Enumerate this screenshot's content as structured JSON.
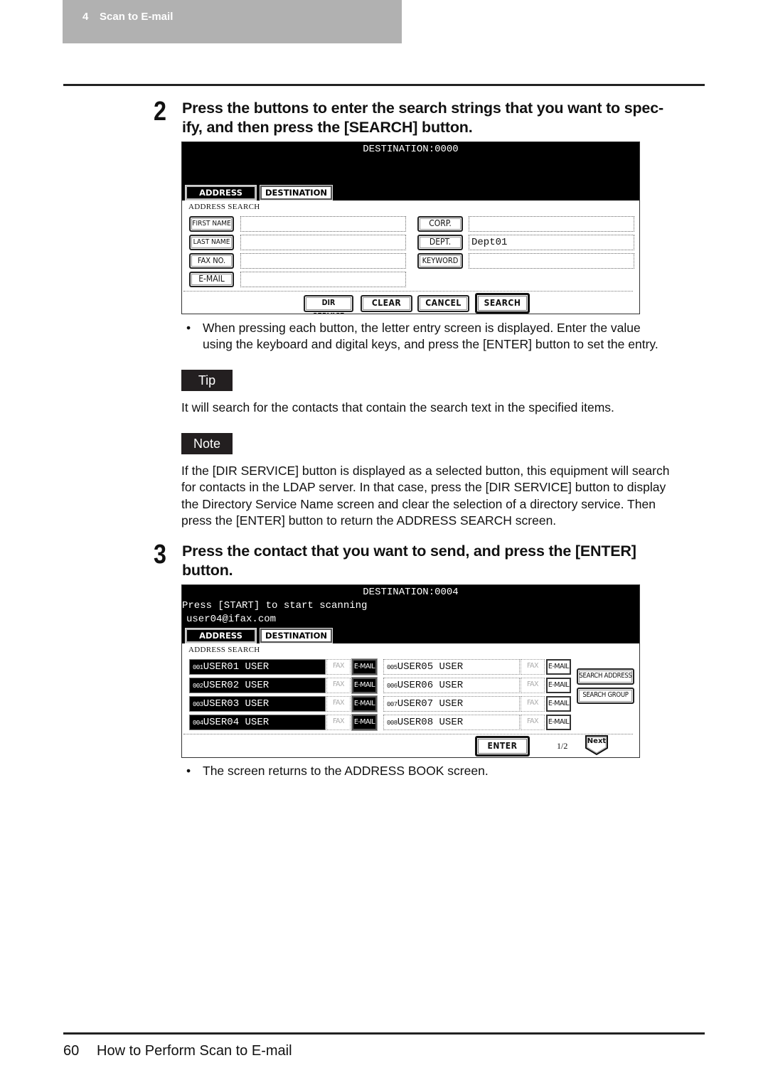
{
  "header": {
    "chapter_number": "4",
    "chapter_title": "Scan to E-mail"
  },
  "step2": {
    "number": "2",
    "instruction": "Press the buttons to enter the search strings that you want to spec-ify, and then press the [SEARCH] button.",
    "instruction_line1": "Press the buttons to enter the search strings that you want to spec-",
    "instruction_line2": "ify, and then press the [SEARCH] button.",
    "screen": {
      "destination": "DESTINATION:0000",
      "tabs": [
        {
          "label": "ADDRESS",
          "active": true
        },
        {
          "label": "DESTINATION",
          "active": false
        }
      ],
      "section_label": "ADDRESS SEARCH",
      "left_fields": [
        {
          "button": "FIRST NAME",
          "value": ""
        },
        {
          "button": "LAST NAME",
          "value": ""
        },
        {
          "button": "FAX NO.",
          "value": ""
        },
        {
          "button": "E-MAIL",
          "value": ""
        }
      ],
      "right_fields": [
        {
          "button": "CORP.",
          "value": ""
        },
        {
          "button": "DEPT.",
          "value": "Dept01"
        },
        {
          "button": "KEYWORD",
          "value": ""
        }
      ],
      "actions": {
        "dir_service": "DIR SERVICE",
        "clear": "CLEAR",
        "cancel": "CANCEL",
        "search": "SEARCH"
      }
    },
    "bullet_line1": "When pressing each button, the letter entry screen is displayed.  Enter the value",
    "bullet_line2": "using the keyboard and digital keys, and press the [ENTER] button to set the entry."
  },
  "tip": {
    "label": "Tip",
    "text": "It will search for the contacts that contain the search text in the specified items."
  },
  "note": {
    "label": "Note",
    "lines": [
      "If the [DIR SERVICE] button is displayed as a selected button, this equipment will search",
      "for contacts in the LDAP server.  In that case, press the [DIR SERVICE] button to display",
      "the Directory Service Name screen and clear the selection of a directory service.  Then",
      "press the [ENTER] button to return the ADDRESS SEARCH screen."
    ]
  },
  "step3": {
    "number": "3",
    "instruction_line1": "Press the contact that you want to send, and press the [ENTER]",
    "instruction_line2": "button.",
    "screen": {
      "destination": "DESTINATION:0004",
      "message": "Press [START] to start scanning",
      "selected_address": "user04@ifax.com",
      "tabs": [
        {
          "label": "ADDRESS",
          "active": true
        },
        {
          "label": "DESTINATION",
          "active": false
        }
      ],
      "section_label": "ADDRESS SEARCH",
      "entries": [
        {
          "index": "001",
          "name": "USER01 USER",
          "selected": true,
          "fax": "FAX",
          "email": "E-MAIL"
        },
        {
          "index": "002",
          "name": "USER02 USER",
          "selected": true,
          "fax": "FAX",
          "email": "E-MAIL"
        },
        {
          "index": "003",
          "name": "USER03 USER",
          "selected": true,
          "fax": "FAX",
          "email": "E-MAIL"
        },
        {
          "index": "004",
          "name": "USER04 USER",
          "selected": true,
          "fax": "FAX",
          "email": "E-MAIL"
        },
        {
          "index": "005",
          "name": "USER05 USER",
          "selected": false,
          "fax": "FAX",
          "email": "E-MAIL"
        },
        {
          "index": "006",
          "name": "USER06 USER",
          "selected": false,
          "fax": "FAX",
          "email": "E-MAIL"
        },
        {
          "index": "007",
          "name": "USER07 USER",
          "selected": false,
          "fax": "FAX",
          "email": "E-MAIL"
        },
        {
          "index": "008",
          "name": "USER08 USER",
          "selected": false,
          "fax": "FAX",
          "email": "E-MAIL"
        }
      ],
      "side_buttons": {
        "search_address": "SEARCH ADDRESS",
        "search_group": "SEARCH GROUP"
      },
      "enter": "ENTER",
      "page_indicator": "1/2",
      "next": "Next"
    },
    "bullet": "The screen returns to the ADDRESS BOOK screen."
  },
  "footer": {
    "page_number": "60",
    "section_title": "How to Perform Scan to E-mail"
  }
}
